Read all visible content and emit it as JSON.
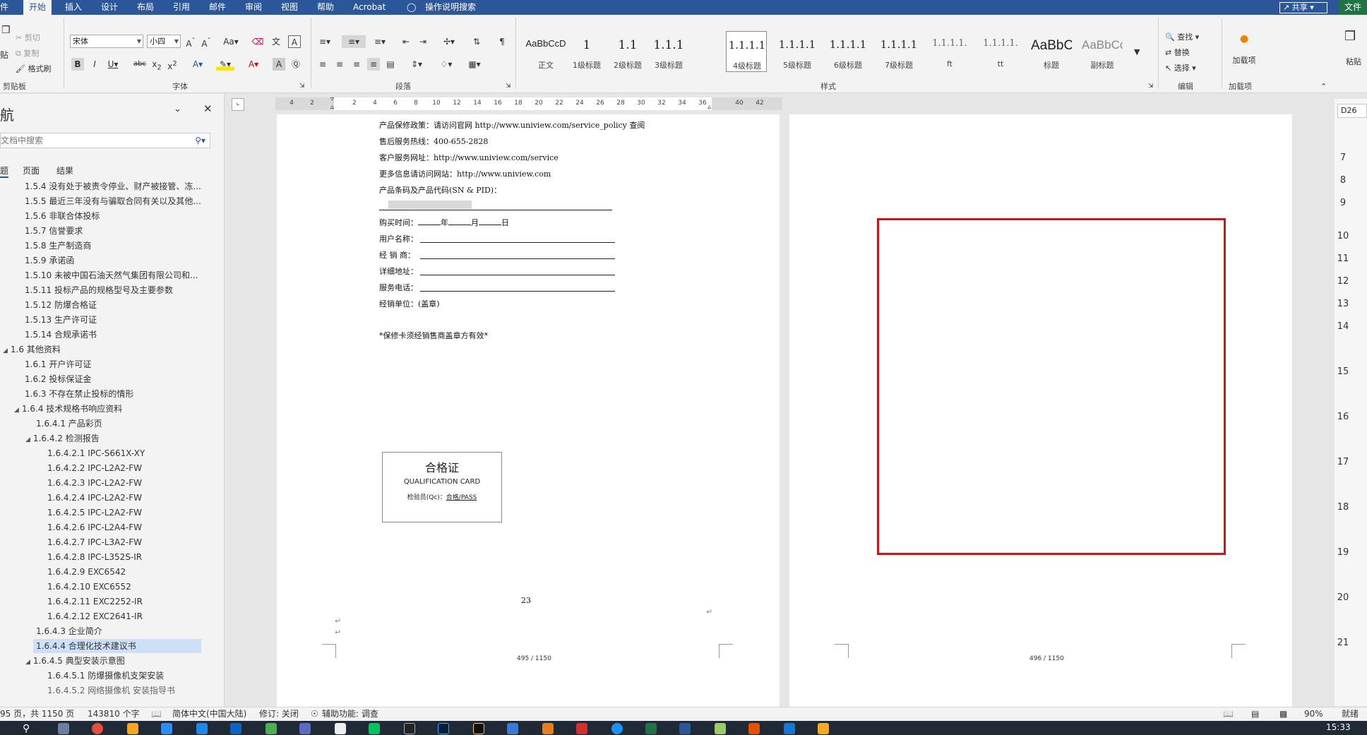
{
  "tabs": [
    "件",
    "开始",
    "插入",
    "设计",
    "布局",
    "引用",
    "邮件",
    "审阅",
    "视图",
    "帮助",
    "Acrobat",
    "操作说明搜索"
  ],
  "share_label": "共享",
  "file_label": "文件",
  "clipboard": {
    "cut": "剪切",
    "copy": "复制",
    "format_painter": "格式刷",
    "paste_partial": "贴",
    "group": "剪贴板"
  },
  "font": {
    "name": "宋体",
    "size": "小四",
    "group": "字体"
  },
  "paragraph_group": "段落",
  "styles": {
    "group": "样式",
    "tiles": [
      {
        "sample": "AaBbCcD",
        "name": "正文"
      },
      {
        "sample": "1",
        "name": "1级标题"
      },
      {
        "sample": "1.1",
        "name": "2级标题"
      },
      {
        "sample": "1.1.1",
        "name": "3级标题"
      },
      {
        "sample": "1.1.1.1",
        "name": "4级标题"
      },
      {
        "sample": "1.1.1.1",
        "name": "5级标题"
      },
      {
        "sample": "1.1.1.1",
        "name": "6级标题"
      },
      {
        "sample": "1.1.1.1",
        "name": "7级标题"
      },
      {
        "sample": "1.1.1.1.",
        "name": "ft"
      },
      {
        "sample": "1.1.1.1.",
        "name": "tt"
      },
      {
        "sample": "AaBbC",
        "name": "标题"
      },
      {
        "sample": "AaBbCc",
        "name": "副标题"
      }
    ]
  },
  "editing": {
    "find": "查找",
    "replace": "替换",
    "select": "选择",
    "group": "编辑"
  },
  "addins": {
    "label": "加载项",
    "group": "加载项"
  },
  "paste_right": "粘贴",
  "nav": {
    "title": "航",
    "search_placeholder": "文档中搜索",
    "tabs": [
      "题",
      "页面",
      "结果"
    ],
    "items": [
      "1.5.4 没有处于被责令停业、财产被接管、冻...",
      "1.5.5 最近三年没有与骗取合同有关以及其他...",
      "1.5.6 非联合体投标",
      "1.5.7 信誉要求",
      "1.5.8 生产制造商",
      "1.5.9 承诺函",
      "1.5.10 未被中国石油天然气集团有限公司和...",
      "1.5.11 投标产品的规格型号及主要参数",
      "1.5.12 防爆合格证",
      "1.5.13 生产许可证",
      "1.5.14 合规承诺书",
      "1.6 其他资料",
      "1.6.1 开户许可证",
      "1.6.2 投标保证金",
      "1.6.3 不存在禁止投标的情形",
      "1.6.4 技术规格书响应资料",
      "1.6.4.1 产品彩页",
      "1.6.4.2 检测报告",
      "1.6.4.2.1 IPC-S661X-XY",
      "1.6.4.2.2 IPC-L2A2-FW",
      "1.6.4.2.3 IPC-L2A2-FW",
      "1.6.4.2.4 IPC-L2A2-FW",
      "1.6.4.2.5 IPC-L2A2-FW",
      "1.6.4.2.6 IPC-L2A4-FW",
      "1.6.4.2.7 IPC-L3A2-FW",
      "1.6.4.2.8 IPC-L352S-IR",
      "1.6.4.2.9 EXC6542",
      "1.6.4.2.10 EXC6552",
      "1.6.4.2.11 EXC2252-IR",
      "1.6.4.2.12 EXC2641-IR",
      "1.6.4.3 企业简介",
      "1.6.4.4 合理化技术建议书",
      "1.6.4.5 典型安装示意图",
      "1.6.4.5.1 防爆摄像机支架安装",
      "1.6.4.5.2 网络摄像机 安装指导书"
    ]
  },
  "ruler_ticks": [
    "4",
    "2",
    "2",
    "4",
    "6",
    "8",
    "10",
    "12",
    "14",
    "16",
    "18",
    "20",
    "22",
    "24",
    "26",
    "28",
    "30",
    "32",
    "34",
    "36",
    "40",
    "42"
  ],
  "page1": {
    "lines": [
      "产品保修政策：请访问官网 http://www.uniview.com/service_policy 查阅",
      "售后服务热线：400-655-2828",
      "客户服务网址：http://www.uniview.com/service",
      "更多信息请访问网站：http://www.uniview.com",
      "产品条码及产品代码(SN & PID)："
    ],
    "purchase_label": "购买时间：",
    "purchase_year": "年",
    "purchase_month": "月",
    "purchase_day": "日",
    "form_fields": [
      "用户名称：",
      "经 销 商：",
      "详细地址：",
      "服务电话："
    ],
    "seal_line": "经销单位：(盖章)",
    "note": "*保修卡须经销售商盖章方有效*",
    "qc_card": {
      "title": "合格证",
      "subtitle": "QUALIFICATION CARD",
      "inspector": "检验员(Qc)：",
      "pass": "合格/PASS"
    },
    "page_number": "23",
    "footer": "495 / 1150"
  },
  "page2": {
    "footer": "496 / 1150"
  },
  "sheet": {
    "cell_ref": "D26",
    "rows": [
      "7",
      "8",
      "9",
      "10",
      "11",
      "12",
      "13",
      "14",
      "15",
      "16",
      "17",
      "18",
      "19",
      "20",
      "21"
    ]
  },
  "status": {
    "page": "95 页，共 1150 页",
    "words": "143810 个字",
    "language": "简体中文(中国大陆)",
    "track": "修订: 关闭",
    "accessibility": "辅助功能: 调查",
    "zoom": "90%",
    "ready": "就绪"
  },
  "clock": "15:33",
  "colors": {
    "word_blue": "#2b579a",
    "excel_green": "#217346",
    "annotation_red": "#d0121b"
  }
}
